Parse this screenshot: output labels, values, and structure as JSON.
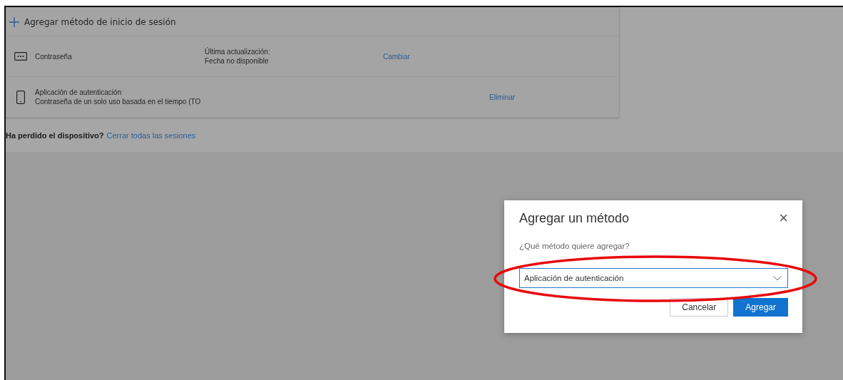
{
  "add_method_link": "Agregar método de inicio de sesión",
  "methods": [
    {
      "kind": "password",
      "title": "Contraseña",
      "info_label": "Última actualización:",
      "info_value": "Fecha no disponible",
      "action": "Cambiar"
    },
    {
      "kind": "phone",
      "title": "Aplicación de autenticación",
      "subtitle": "Contraseña de un solo uso basada en el tiempo (TO",
      "action": "Eliminar"
    }
  ],
  "lost_device": {
    "question": "Ha perdido el dispositivo?",
    "link": "Cerrar todas las sesiones"
  },
  "dialog": {
    "title": "Agregar un método",
    "close": "×",
    "prompt": "¿Qué método quiere agregar?",
    "select_value": "Aplicación de autenticación",
    "highlighted": true,
    "buttons": [
      {
        "label": "Cancelar",
        "kind": "secondary"
      },
      {
        "label": "Agregar",
        "kind": "primary"
      }
    ]
  }
}
